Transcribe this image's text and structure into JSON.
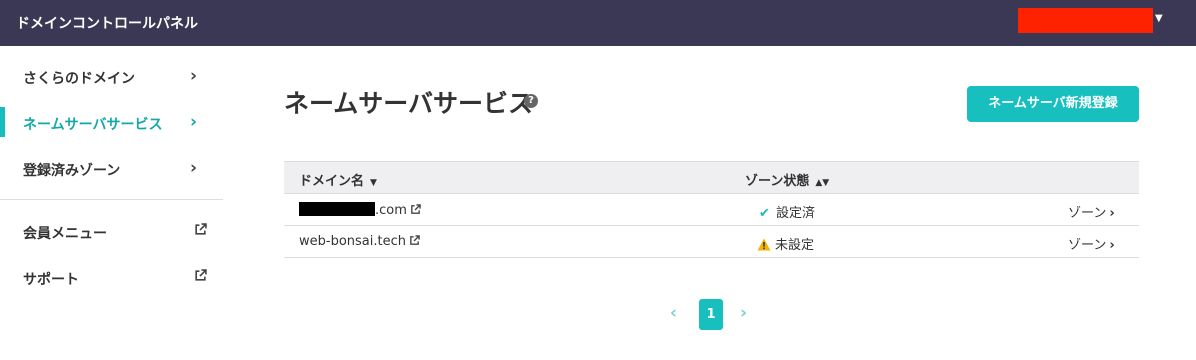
{
  "header": {
    "app_title": "ドメインコントロールパネル",
    "user_redacted_color": "#ff2200"
  },
  "sidebar": {
    "items": [
      {
        "label": "さくらのドメイン",
        "icon": "chevron-right-icon"
      },
      {
        "label": "ネームサーバサービス",
        "icon": "chevron-right-icon",
        "active": true
      },
      {
        "label": "登録済みゾーン",
        "icon": "chevron-right-icon"
      },
      {
        "label": "会員メニュー",
        "icon": "external-link-icon"
      },
      {
        "label": "サポート",
        "icon": "external-link-icon"
      }
    ]
  },
  "main": {
    "title": "ネームサーバサービス",
    "help_icon": "question-circle-icon",
    "new_button": "ネームサーバ新規登録",
    "table": {
      "headers": {
        "domain": "ドメイン名",
        "zone_status": "ゾーン状態"
      },
      "rows": [
        {
          "domain_suffix": ".com",
          "status": "設定済",
          "status_icon": "check-icon",
          "zone_link": "ゾーン"
        },
        {
          "domain": "web-bonsai.tech",
          "status": "未設定",
          "status_icon": "warning-icon",
          "zone_link": "ゾーン"
        }
      ]
    },
    "pagination": {
      "current_page": "1"
    }
  },
  "colors": {
    "topbar": "#3a3854",
    "accent": "#17bfbf",
    "warning": "#f5b400"
  }
}
